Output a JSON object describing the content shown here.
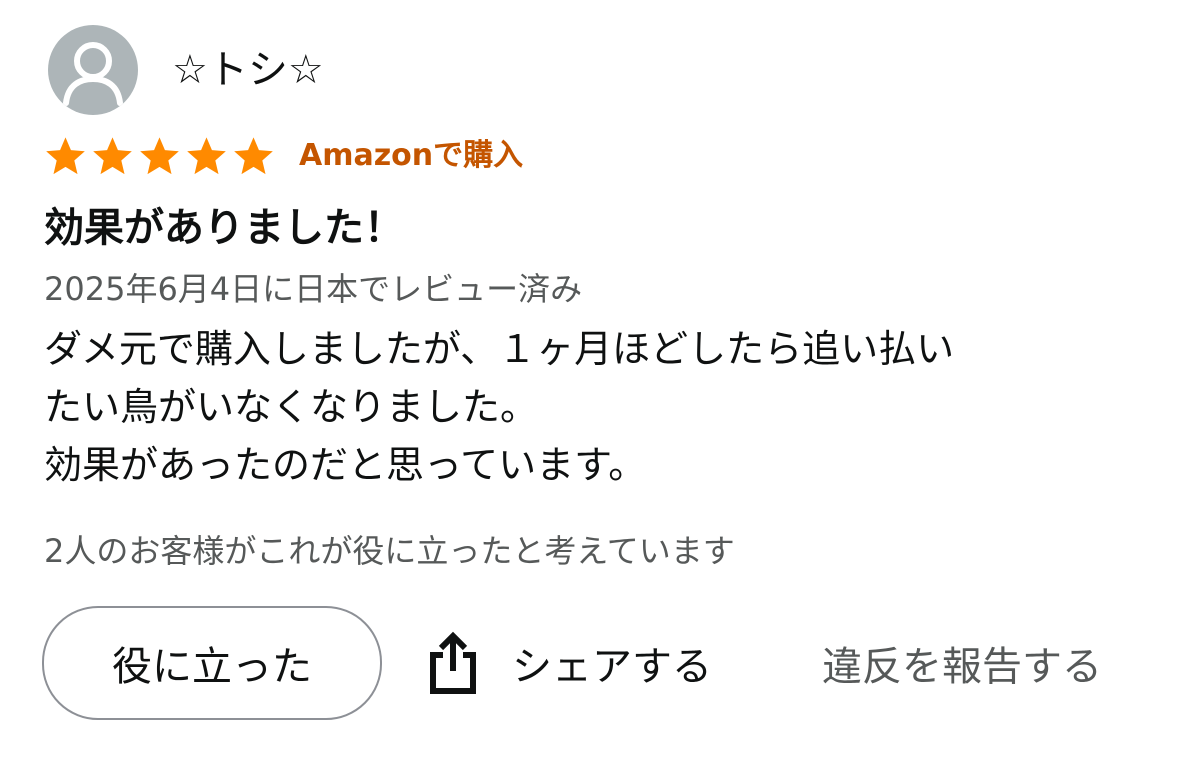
{
  "review": {
    "reviewer_name": "☆トシ☆",
    "rating": 5,
    "rating_max": 5,
    "verified_label": "Amazonで購入",
    "title": "効果がありました！",
    "date_line": "2025年6月4日に日本でレビュー済み",
    "body_lines": [
      "ダメ元で購入しましたが、１ヶ月ほどしたら追い払い",
      "たい鳥がいなくなりました。",
      "効果があったのだと思っています。"
    ],
    "helpful_count_text": "2人のお客様がこれが役に立ったと考えています"
  },
  "actions": {
    "helpful_label": "役に立った",
    "share_label": "シェアする",
    "report_label": "違反を報告する"
  },
  "icons": {
    "avatar": "user-silhouette-icon",
    "star": "star-filled-icon",
    "share": "share-up-arrow-icon"
  },
  "colors": {
    "star": "#ff8a00",
    "verified": "#c45500",
    "avatar_bg": "#adb5b8",
    "secondary_text": "#565959",
    "button_border": "#8d9096"
  }
}
